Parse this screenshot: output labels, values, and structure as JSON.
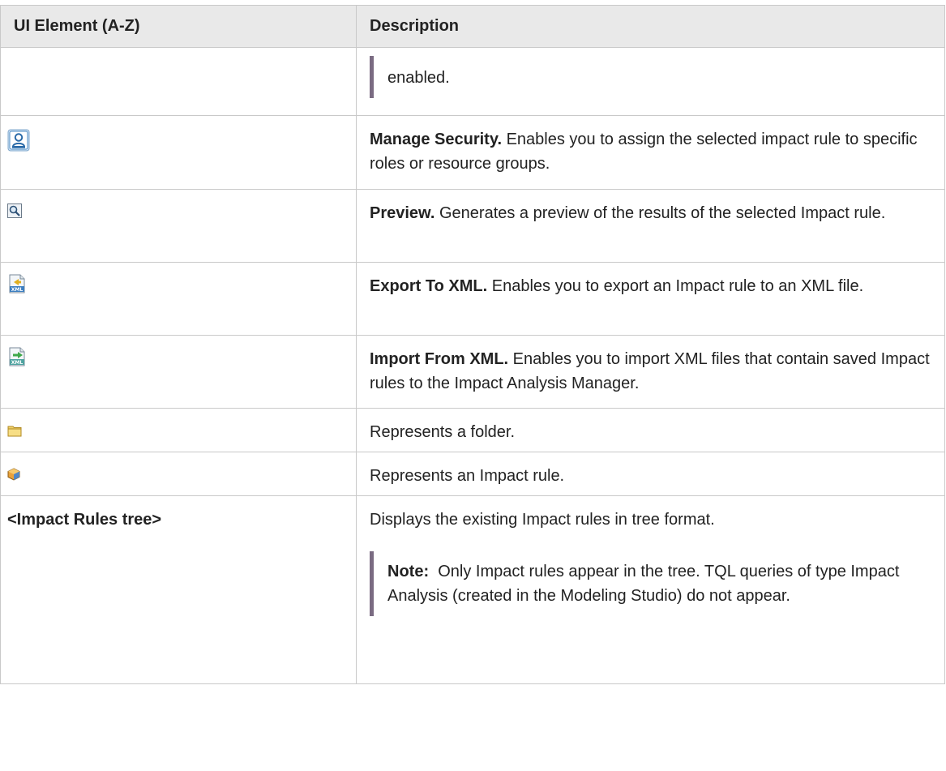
{
  "table": {
    "headers": [
      "UI Element (A-Z)",
      "Description"
    ],
    "rows": [
      {
        "element_text": "",
        "icon": "",
        "bold": "",
        "text": "enabled."
      },
      {
        "element_text": "",
        "icon": "manage-security-icon",
        "bold": "Manage Security.",
        "text": " Enables you to assign the selected impact rule to specific roles or resource groups."
      },
      {
        "element_text": "",
        "icon": "preview-icon",
        "bold": "Preview.",
        "text": " Generates a preview of the results of the selected Impact rule."
      },
      {
        "element_text": "",
        "icon": "export-xml-icon",
        "bold": "Export To XML.",
        "text": " Enables you to export an Impact rule to an XML file."
      },
      {
        "element_text": "",
        "icon": "import-xml-icon",
        "bold": "Import From XML.",
        "text": " Enables you to import XML files that contain saved Impact rules to the Impact Analysis Manager."
      },
      {
        "element_text": "",
        "icon": "folder-icon",
        "bold": "",
        "text": "Represents a folder."
      },
      {
        "element_text": "",
        "icon": "impact-rule-icon",
        "bold": "",
        "text": "Represents an Impact rule."
      },
      {
        "element_text": "<Impact Rules tree>",
        "icon": "",
        "bold": "",
        "text": "Displays the existing Impact rules in tree format.",
        "note_label": "Note:",
        "note_text": "  Only Impact rules appear in the tree. TQL queries of type Impact Analysis (created in the Modeling Studio) do not appear."
      }
    ]
  },
  "icon_text": {
    "xml": "XML"
  },
  "colors": {
    "header_bg": "#e9e9e9",
    "border": "#c9c9c9",
    "note_bar": "#7a6b82"
  }
}
